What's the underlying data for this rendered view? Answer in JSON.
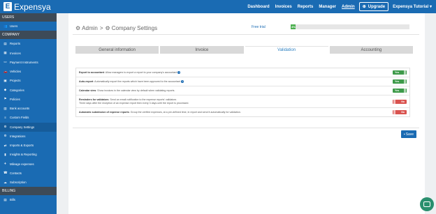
{
  "app": {
    "logo_letter": "E",
    "name": "Expensya"
  },
  "topnav": {
    "items": [
      "Dashboard",
      "Invoices",
      "Reports",
      "Manager",
      "Admin"
    ],
    "upgrade": "Upgrade",
    "tutorial": "Expensya Tutorial ▾"
  },
  "sidebar": {
    "sections": [
      {
        "header": "USERS",
        "items": [
          {
            "label": "Users",
            "icon": "users-icon",
            "glyph": "👥"
          }
        ]
      },
      {
        "header": "COMPANY",
        "items": [
          {
            "label": "Reports",
            "icon": "reports-icon",
            "glyph": "▤"
          },
          {
            "label": "Invoices",
            "icon": "invoices-icon",
            "glyph": "▦"
          },
          {
            "label": "Payment Instruments",
            "icon": "card-icon",
            "glyph": "▭"
          },
          {
            "label": "Vehicles",
            "icon": "car-icon",
            "glyph": "🚗"
          },
          {
            "label": "Projects",
            "icon": "projects-icon",
            "glyph": "▣"
          },
          {
            "label": "Categories",
            "icon": "tag-icon",
            "glyph": "◆"
          },
          {
            "label": "Policies",
            "icon": "policy-icon",
            "glyph": "⚑"
          },
          {
            "label": "Bank accounts",
            "icon": "bank-icon",
            "glyph": "▥"
          },
          {
            "label": "Custom Fields",
            "icon": "fields-icon",
            "glyph": "≡"
          },
          {
            "label": "Company Settings",
            "icon": "gear-icon",
            "glyph": "⚙"
          },
          {
            "label": "Integrations",
            "icon": "integrations-icon",
            "glyph": "⚙"
          },
          {
            "label": "Imports & Exports",
            "icon": "import-export-icon",
            "glyph": "⇄"
          },
          {
            "label": "Insights & Reporting",
            "icon": "insights-icon",
            "glyph": "▮"
          },
          {
            "label": "Mileage expenses",
            "icon": "mileage-icon",
            "glyph": "✈"
          },
          {
            "label": "Contacts",
            "icon": "contacts-icon",
            "glyph": "☎"
          },
          {
            "label": "Subscription",
            "icon": "subscription-icon",
            "glyph": "☁"
          }
        ]
      },
      {
        "header": "BILLING",
        "items": [
          {
            "label": "Bills",
            "icon": "bills-icon",
            "glyph": "▤"
          }
        ]
      }
    ],
    "active": "Company Settings"
  },
  "page": {
    "title_admin": "Admin",
    "title_sep": ">",
    "title_main": "Company Settings",
    "free_trial_label": "Free trial",
    "free_trial_percent": 4,
    "free_trial_text": "4%"
  },
  "tabs": [
    {
      "label": "General information",
      "active": false
    },
    {
      "label": "Invoice",
      "active": false
    },
    {
      "label": "Validation",
      "active": true
    },
    {
      "label": "Accounting",
      "active": false
    }
  ],
  "settings": [
    {
      "title": "Export to accountant",
      "desc": ": Allow managers to export a report to your company's accountant",
      "help": true,
      "extra": "",
      "toggle": "Yes"
    },
    {
      "title": "Auto-export",
      "desc": ": Automatically export the reports which have been approved to the accountant",
      "help": true,
      "extra": "",
      "toggle": "Yes"
    },
    {
      "title": "Calendar view",
      "desc": ": Show invoices in the calendar view by default when validating reports.",
      "help": false,
      "extra": "",
      "toggle": "Yes"
    },
    {
      "title": "Reminders for validators",
      "desc": ": Send an email notification to the expense reports' validators",
      "help": false,
      "extra": "Three days after the reception of an expense report then every 3 days until the report is processed.",
      "toggle": "No"
    },
    {
      "title": "Automatic submission of expense reports",
      "desc": ": Group the verified expenses, at a pre-defined time, in report and send it automatically for validation.",
      "help": false,
      "extra": "",
      "toggle": "No"
    }
  ],
  "save_label": "Save"
}
